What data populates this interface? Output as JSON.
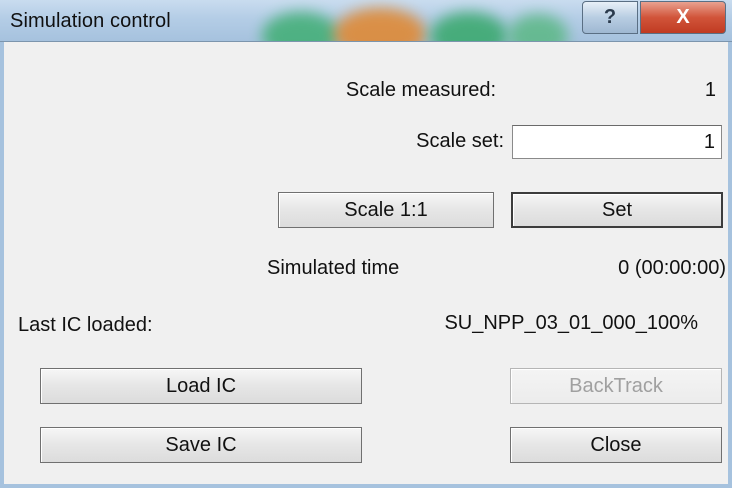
{
  "window": {
    "title": "Simulation control",
    "help_glyph": "?",
    "close_glyph": "X"
  },
  "scale": {
    "measured_label": "Scale measured:",
    "measured_value": "1",
    "set_label": "Scale set:",
    "set_value": "1",
    "scale_1_1_label": "Scale 1:1",
    "set_button_label": "Set"
  },
  "simulation": {
    "time_label": "Simulated time",
    "time_value": "0 (00:00:00)"
  },
  "ic": {
    "last_loaded_label": "Last IC loaded:",
    "last_loaded_value": "SU_NPP_03_01_000_100%"
  },
  "buttons": {
    "load_ic": "Load IC",
    "backtrack": "BackTrack",
    "save_ic": "Save IC",
    "close": "Close"
  }
}
